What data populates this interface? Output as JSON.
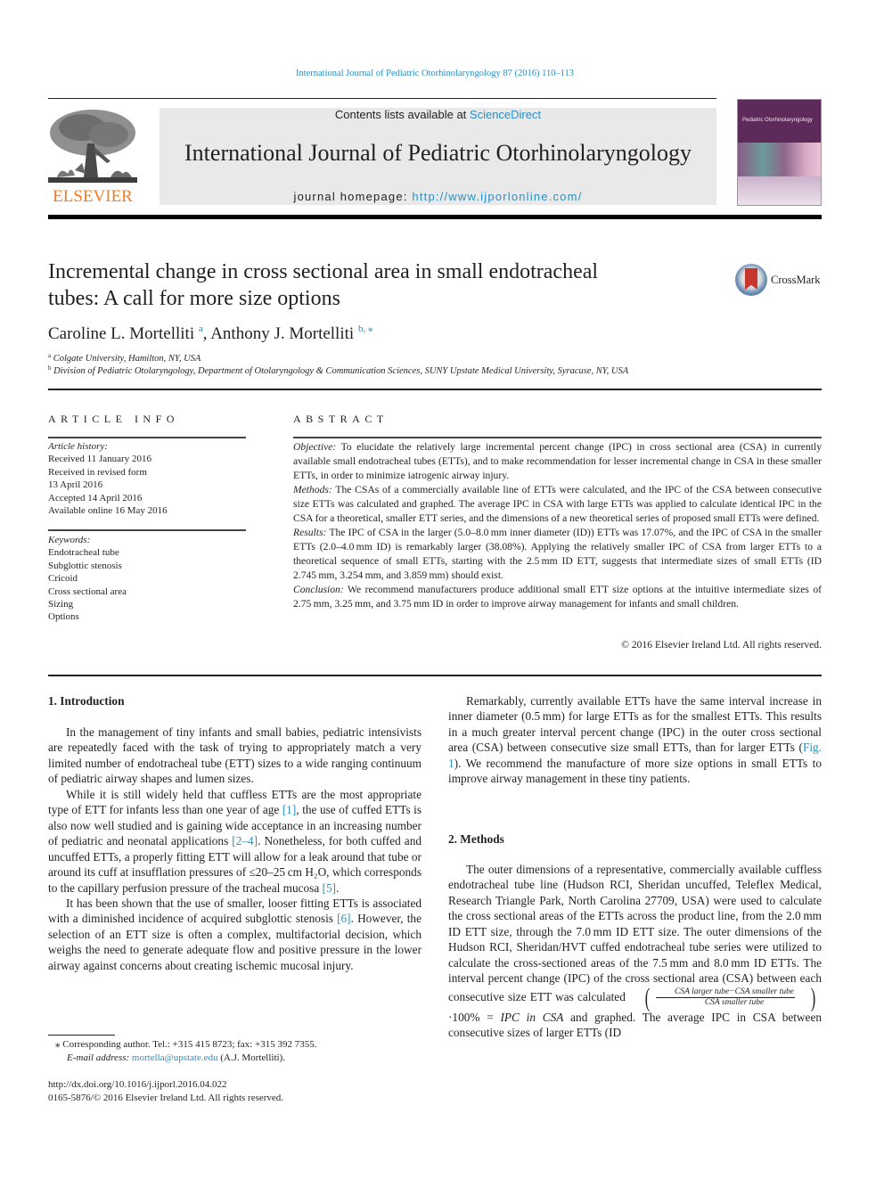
{
  "running_head": "International Journal of Pediatric Otorhinolaryngology 87 (2016) 110–113",
  "masthead": {
    "publisher": "ELSEVIER",
    "contents_prefix": "Contents lists available at ",
    "contents_link": "ScienceDirect",
    "journal_title": "International Journal of Pediatric Otorhinolaryngology",
    "homepage_prefix": "journal homepage: ",
    "homepage_url": "http://www.ijporlonline.com/",
    "cover_title": "Pediatric Otorhinolaryngology"
  },
  "article": {
    "title_line1": "Incremental change in cross sectional area in small endotracheal",
    "title_line2": "tubes: A call for more size options",
    "crossmark_label": "CrossMark",
    "authors": [
      {
        "name": "Caroline L. Mortelliti",
        "sup": "a"
      },
      {
        "name": "Anthony J. Mortelliti",
        "sup": "b, ⁎"
      }
    ],
    "author_separator": ", ",
    "affiliations": [
      {
        "sup": "a",
        "text": "Colgate University, Hamilton, NY, USA"
      },
      {
        "sup": "b",
        "text": "Division of Pediatric Otolaryngology, Department of Otolaryngology & Communication Sciences, SUNY Upstate Medical University, Syracuse, NY, USA"
      }
    ]
  },
  "article_info": {
    "heading": "ARTICLE INFO",
    "history_label": "Article history:",
    "history": [
      "Received 11 January 2016",
      "Received in revised form",
      "13 April 2016",
      "Accepted 14 April 2016",
      "Available online 16 May 2016"
    ],
    "keywords_label": "Keywords:",
    "keywords": [
      "Endotracheal tube",
      "Subglottic stenosis",
      "Cricoid",
      "Cross sectional area",
      "Sizing",
      "Options"
    ]
  },
  "abstract": {
    "heading": "ABSTRACT",
    "objective_label": "Objective:",
    "objective": "To elucidate the relatively large incremental percent change (IPC) in cross sectional area (CSA) in currently available small endotracheal tubes (ETTs), and to make recommendation for lesser incremental change in CSA in these smaller ETTs, in order to minimize iatrogenic airway injury.",
    "methods_label": "Methods:",
    "methods": "The CSAs of a commercially available line of ETTs were calculated, and the IPC of the CSA between consecutive size ETTs was calculated and graphed. The average IPC in CSA with large ETTs was applied to calculate identical IPC in the CSA for a theoretical, smaller ETT series, and the dimensions of a new theoretical series of proposed small ETTs were defined.",
    "results_label": "Results:",
    "results": "The IPC of CSA in the larger (5.0–8.0 mm inner diameter (ID)) ETTs was 17.07%, and the IPC of CSA in the smaller ETTs (2.0–4.0 mm ID) is remarkably larger (38.08%). Applying the relatively smaller IPC of CSA from larger ETTs to a theoretical sequence of small ETTs, starting with the 2.5 mm ID ETT, suggests that intermediate sizes of small ETTs (ID 2.745 mm, 3.254 mm, and 3.859 mm) should exist.",
    "conclusion_label": "Conclusion:",
    "conclusion": "We recommend manufacturers produce additional small ETT size options at the intuitive intermediate sizes of 2.75 mm, 3.25 mm, and 3.75 mm ID in order to improve airway management for infants and small children.",
    "copyright": "© 2016 Elsevier Ireland Ltd. All rights reserved."
  },
  "body": {
    "intro_heading": "1.  Introduction",
    "intro_p1": "In the management of tiny infants and small babies, pediatric intensivists are repeatedly faced with the task of trying to appropriately match a very limited number of endotracheal tube (ETT) sizes to a wide ranging continuum of pediatric airway shapes and lumen sizes.",
    "intro_p2_a": "While it is still widely held that cuffless ETTs are the most appropriate type of ETT for infants less than one year of age ",
    "intro_p2_ref1": "[1]",
    "intro_p2_b": ", the use of cuffed ETTs is also now well studied and is gaining wide acceptance in an increasing number of pediatric and neonatal applications ",
    "intro_p2_ref2": "[2–4]",
    "intro_p2_c": ". Nonetheless, for both cuffed and uncuffed ETTs, a properly fitting ETT will allow for a leak around that tube or around its cuff at insufflation pressures of ≤20–25 cm H₂O, which corresponds to the capillary perfusion pressure of the tracheal mucosa ",
    "intro_p2_ref3": "[5]",
    "intro_p2_d": ".",
    "intro_p3_a": "It has been shown that the use of smaller, looser fitting ETTs is associated with a diminished incidence of acquired subglottic stenosis ",
    "intro_p3_ref": "[6]",
    "intro_p3_b": ". However, the selection of an ETT size is often a complex, multifactorial decision, which weighs the need to generate adequate flow and positive pressure in the lower airway against concerns about creating ischemic mucosal injury.",
    "right_p1_a": "Remarkably, currently available ETTs have the same interval increase in inner diameter (0.5 mm) for large ETTs as for the smallest ETTs. This results in a much greater interval percent change (IPC) in the outer cross sectional area (CSA) between consecutive size small ETTs, than for larger ETTs (",
    "right_p1_ref": "Fig. 1",
    "right_p1_b": "). We recommend the manufacture of more size options in small ETTs to improve airway management in these tiny patients.",
    "methods_heading": "2.  Methods",
    "methods_p1_a": "The outer dimensions of a representative, commercially available cuffless endotracheal tube line (Hudson RCI, Sheridan uncuffed, Teleflex Medical, Research Triangle Park, North Carolina 27709, USA) were used to calculate the cross sectional areas of the ETTs across the product line, from the 2.0 mm ID ETT size, through the 7.0 mm ID ETT size. The outer dimensions of the Hudson RCI, Sheridan/HVT cuffed endotracheal tube series were utilized to calculate the cross-sectioned areas of the 7.5 mm and 8.0 mm ID ETTs. The interval percent change (IPC) of the cross sectional area (CSA) between each consecutive size ETT was calculated ",
    "formula_numerator": "CSA larger tube−CSA smaller tube",
    "formula_denominator": "CSA smaller tube",
    "formula_rest": "·100% = ",
    "formula_result": "IPC in CSA",
    "methods_p1_b": " and graphed. The average IPC in CSA between consecutive sizes of larger ETTs (ID"
  },
  "footnotes": {
    "corresponding": "⁎  Corresponding author. Tel.: +315 415 8723; fax: +315 392 7355.",
    "email_label": "E-mail address: ",
    "email": "mortella@upstate.edu",
    "email_suffix": " (A.J. Mortelliti).",
    "doi_url": "http://dx.doi.org/10.1016/j.ijporl.2016.04.022",
    "issn_line": "0165-5876/© 2016 Elsevier Ireland Ltd. All rights reserved."
  },
  "colors": {
    "link": "#2b8fc1",
    "elsevier_orange": "#f47b20",
    "masthead_gray": "#e9e9e9",
    "cover_purple": "#5e2a5a"
  }
}
